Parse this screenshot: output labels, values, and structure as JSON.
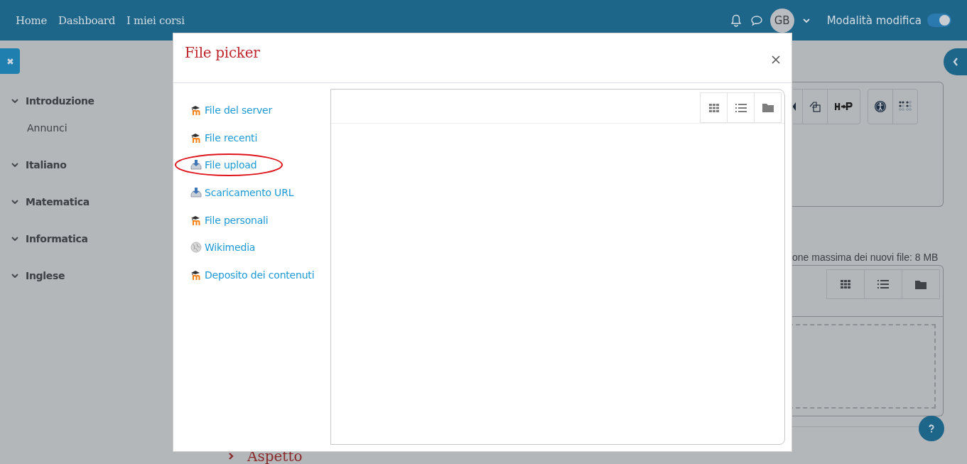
{
  "navbar": {
    "links": [
      "Home",
      "Dashboard",
      "I miei corsi"
    ],
    "avatar": "GB",
    "edit_mode": {
      "label": "Modalità modifica",
      "on": true
    }
  },
  "course_index": [
    {
      "title": "Introduzione",
      "expanded": true,
      "children": [
        {
          "title": "Annunci"
        }
      ]
    },
    {
      "title": "Italiano",
      "expanded": true
    },
    {
      "title": "Matematica",
      "expanded": true
    },
    {
      "title": "Informatica",
      "expanded": true
    },
    {
      "title": "Inglese",
      "expanded": true
    }
  ],
  "file_manager": {
    "note": "one massima dei nuovi file: 8 MB"
  },
  "section": {
    "title": "Aspetto",
    "expanded": false
  },
  "dialog": {
    "title": "File picker",
    "repositories": [
      {
        "label": "File del server",
        "kind": "moodle",
        "highlighted": false
      },
      {
        "label": "File recenti",
        "kind": "moodle",
        "highlighted": false
      },
      {
        "label": "File upload",
        "kind": "upload",
        "highlighted": true
      },
      {
        "label": "Scaricamento URL",
        "kind": "upload",
        "highlighted": false
      },
      {
        "label": "File personali",
        "kind": "moodle",
        "highlighted": false
      },
      {
        "label": "Wikimedia",
        "kind": "wikimedia",
        "highlighted": false
      },
      {
        "label": "Deposito dei contenuti",
        "kind": "moodle",
        "highlighted": false
      }
    ]
  }
}
